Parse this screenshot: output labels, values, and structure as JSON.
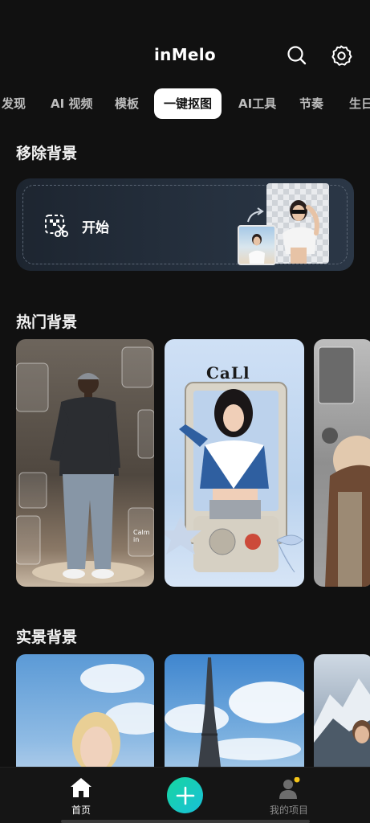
{
  "header": {
    "title": "inMelo",
    "search_icon": "search-icon",
    "settings_icon": "gear-icon"
  },
  "tabs": [
    {
      "label": "发现"
    },
    {
      "label": "AI 视频"
    },
    {
      "label": "模板"
    },
    {
      "label": "一键抠图",
      "active": true
    },
    {
      "label": "AI工具"
    },
    {
      "label": "节奏"
    },
    {
      "label": "生日"
    }
  ],
  "remove_bg": {
    "title": "移除背景",
    "start_label": "开始",
    "icon": "cutout-scissors-icon"
  },
  "hot_bg": {
    "title": "热门背景",
    "thumbs": [
      {
        "caption": "Calm in"
      },
      {
        "caption": "CaLl"
      },
      {
        "caption": ""
      }
    ]
  },
  "real_bg": {
    "title": "实景背景"
  },
  "bottom_nav": {
    "home_label": "首页",
    "add_icon": "plus-icon",
    "projects_label": "我的项目"
  },
  "colors": {
    "accent_plus": "#16d6a0",
    "badge": "#f5c518",
    "active_tab_bg": "#ffffff"
  }
}
